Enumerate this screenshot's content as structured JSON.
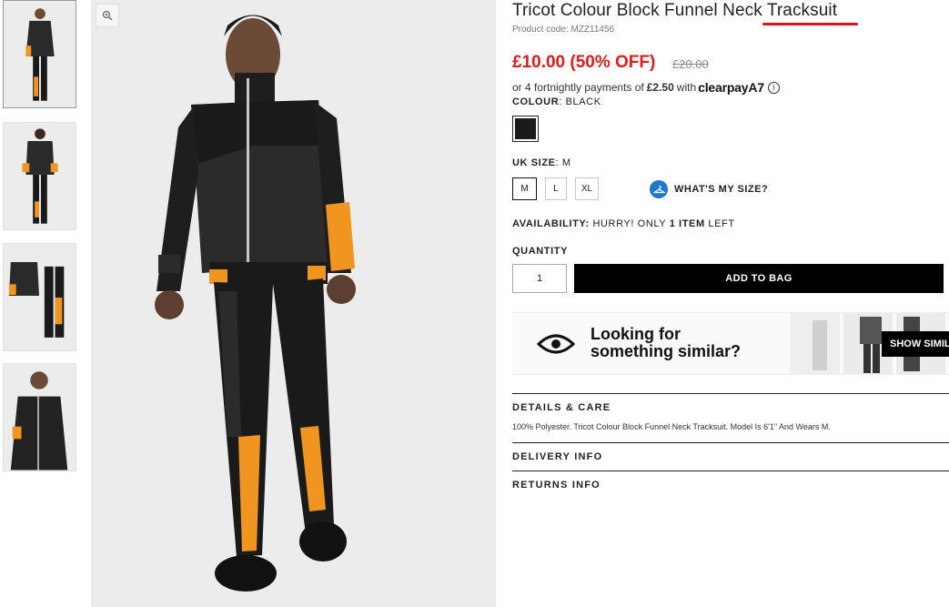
{
  "product": {
    "title": "Tricot Colour Block Funnel Neck Tracksuit",
    "product_code": "Product code: MZZ11456",
    "price": "£10.00 (50% OFF)",
    "old_price": "£20.00"
  },
  "clearpay": {
    "prefix": "or 4 fortnightly payments of",
    "amount": "£2.50",
    "with": "with",
    "logo": "clearpay",
    "logo_mark": "A7",
    "info_icon": "info-circle-icon"
  },
  "colour": {
    "label": "COLOUR",
    "value": ": BLACK",
    "swatch_color": "#1b1b1b"
  },
  "size": {
    "label": "UK SIZE",
    "value": ": M",
    "options": [
      "M",
      "L",
      "XL"
    ],
    "selected": "M",
    "guide_label": "WHAT'S MY SIZE?",
    "guide_icon": "hanger-icon"
  },
  "availability": {
    "label": "AVAILABILITY:",
    "text_pre": "HURRY! ONLY",
    "count": "1 ITEM",
    "text_post": "LEFT"
  },
  "quantity": {
    "label": "QUANTITY",
    "value": "1"
  },
  "add_to_bag": "ADD TO BAG",
  "similar": {
    "line1": "Looking for",
    "line2": "something similar?",
    "button": "SHOW SIMIL",
    "icon": "eye-icon"
  },
  "details": {
    "title": "DETAILS & CARE",
    "body": "100% Polyester. Tricot Colour Block Funnel Neck Tracksuit. Model Is 6'1\" And Wears M."
  },
  "delivery": {
    "title": "DELIVERY INFO"
  },
  "returns": {
    "title": "RETURNS INFO"
  },
  "gallery": {
    "zoom_icon": "zoom-icon",
    "thumbnail_count": 4,
    "active_index": 0
  },
  "colors": {
    "sale_red": "#e41b17",
    "accent_orange": "#f0951f",
    "garment_black": "#1a1a1a"
  }
}
